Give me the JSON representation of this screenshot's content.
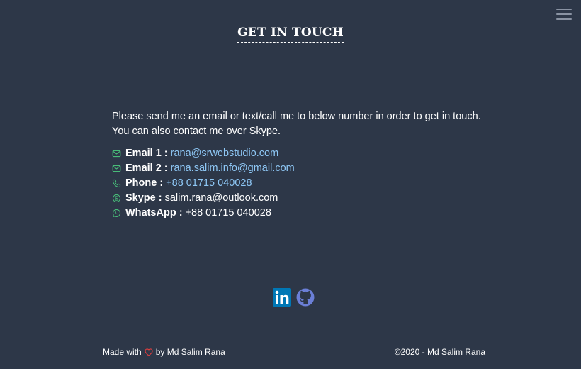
{
  "header": {
    "title": "GET IN TOUCH",
    "menu_icon": "hamburger-menu-icon"
  },
  "intro": {
    "line1": "Please send me an email or text/call me to below number in order to get in touch.",
    "line2": "You can also contact me over Skype."
  },
  "contacts": [
    {
      "icon": "envelope-icon",
      "label": "Email 1 :",
      "value": "rana@srwebstudio.com",
      "is_link": true
    },
    {
      "icon": "envelope-icon",
      "label": "Email 2 :",
      "value": "rana.salim.info@gmail.com",
      "is_link": true
    },
    {
      "icon": "phone-icon",
      "label": "Phone :",
      "value": "+88 01715 040028",
      "is_link": true
    },
    {
      "icon": "skype-icon",
      "label": "Skype :",
      "value": "salim.rana@outlook.com",
      "is_link": false
    },
    {
      "icon": "whatsapp-icon",
      "label": "WhatsApp :",
      "value": "+88 01715 040028",
      "is_link": false
    }
  ],
  "social": {
    "linkedin_icon": "linkedin-icon",
    "github_icon": "github-icon"
  },
  "footer": {
    "made_with": "Made with",
    "by": "by Md Salim Rana",
    "copyright": "©2020 - Md Salim Rana"
  },
  "colors": {
    "background": "#2d3748",
    "link": "#8ec7f5",
    "icon_green": "#48bb78",
    "heart": "#e53e3e",
    "linkedin": "#0077b5",
    "github": "#6b7fd7"
  }
}
